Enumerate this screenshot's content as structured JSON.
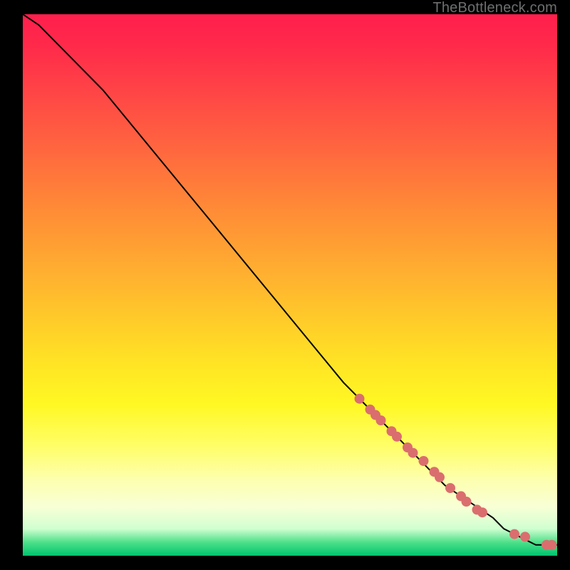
{
  "watermark": "TheBottleneck.com",
  "colors": {
    "line": "#000000",
    "marker_fill": "#da6e6e",
    "marker_stroke": "#c85a5a"
  },
  "chart_data": {
    "type": "line",
    "title": "",
    "xlabel": "",
    "ylabel": "",
    "xlim": [
      0,
      100
    ],
    "ylim": [
      0,
      100
    ],
    "grid": false,
    "legend_position": null,
    "series": [
      {
        "name": "curve",
        "type": "line",
        "x": [
          0,
          3,
          6,
          10,
          15,
          20,
          25,
          30,
          35,
          40,
          45,
          50,
          55,
          60,
          63,
          66,
          70,
          73,
          76,
          79,
          82,
          85,
          88,
          90,
          92,
          94,
          96,
          98,
          100
        ],
        "y": [
          100,
          98,
          95,
          91,
          86,
          80,
          74,
          68,
          62,
          56,
          50,
          44,
          38,
          32,
          29,
          26,
          22,
          19,
          16,
          13,
          11,
          9,
          7,
          5,
          4,
          3,
          2,
          2,
          2
        ]
      },
      {
        "name": "highlighted-points",
        "type": "scatter",
        "x": [
          63,
          65,
          66,
          67,
          69,
          70,
          72,
          73,
          75,
          77,
          78,
          80,
          82,
          83,
          85,
          86,
          92,
          94,
          98,
          99
        ],
        "y": [
          29,
          27,
          26,
          25,
          23,
          22,
          20,
          19,
          17.5,
          15.5,
          14.5,
          12.5,
          11,
          10,
          8.5,
          8,
          4,
          3.5,
          2,
          2
        ]
      }
    ]
  }
}
